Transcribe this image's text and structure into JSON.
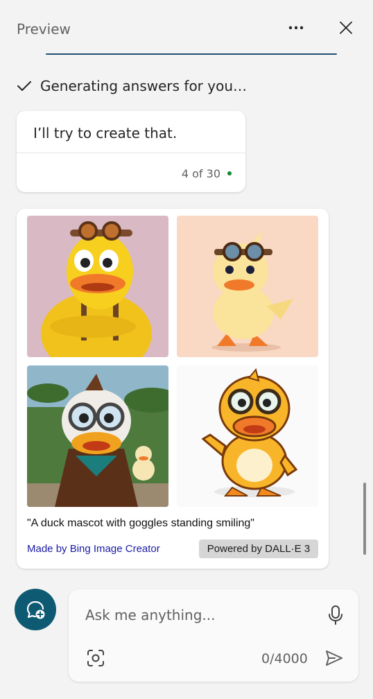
{
  "header": {
    "title": "Preview",
    "more_icon": "more-horizontal-icon",
    "close_icon": "close-icon"
  },
  "status": {
    "icon": "checkmark-icon",
    "text": "Generating answers for you…"
  },
  "message": {
    "text": "I’ll try to create that.",
    "counter": "4 of 30",
    "counter_dot_color": "#128a2a"
  },
  "image_card": {
    "images": [
      {
        "alt": "duck mascot with goggles, arms crossed"
      },
      {
        "alt": "small cartoon duckling with goggles"
      },
      {
        "alt": "duck mascot costume waving with small duck figurine"
      },
      {
        "alt": "cartoon duck with goggles pointing"
      }
    ],
    "prompt": "\"A duck mascot with goggles standing smiling\"",
    "credit": "Made by Bing Image Creator",
    "powered_by": "Powered by DALL·E 3"
  },
  "composer": {
    "placeholder": "Ask me anything...",
    "char_count": "0/4000",
    "accent": "#0e5a73"
  }
}
